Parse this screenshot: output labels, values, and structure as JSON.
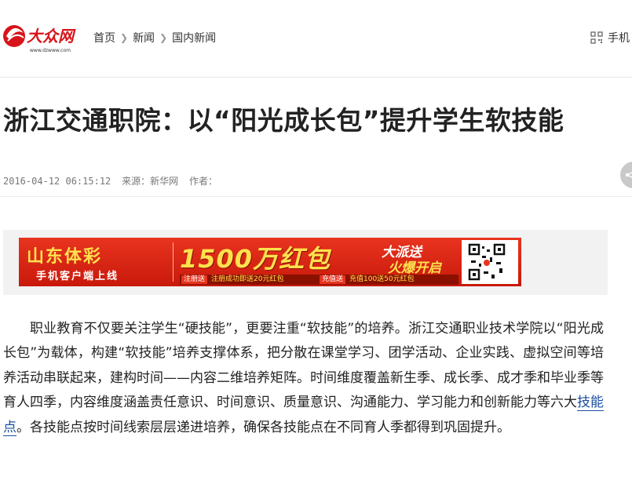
{
  "logo": {
    "name": "大众网",
    "domain": "www.dzwww.com"
  },
  "breadcrumb": {
    "items": [
      "首页",
      "新闻",
      "国内新闻"
    ]
  },
  "header": {
    "mobile_label": "手机"
  },
  "article": {
    "title": "浙江交通职院：以“阳光成长包”提升学生软技能",
    "date": "2016-04-12 06:15:12",
    "source": "来源：新华网",
    "author": "作者：",
    "body_before_link": "职业教育不仅要关注学生“硬技能”，更要注重“软技能”的培养。浙江交通职业技术学院以“阳光成长包”为载体，构建“软技能”培养支撑体系，把分散在课堂学习、团学活动、企业实践、虚拟空间等培养活动串联起来，建构时间——内容二维培养矩阵。时间维度覆盖新生季、成长季、成才季和毕业季等育人四季，内容维度涵盖责任意识、时间意识、质量意识、沟通能力、学习能力和创新能力等六大",
    "link_text": "技能点",
    "body_after_link": "。各技能点按时间线索层层递进培养，确保各技能点在不同育人季都得到巩固提升。"
  },
  "ad": {
    "brand": "山东体彩",
    "brand_sub": "手机客户端上线",
    "headline": "1500万红包",
    "slogan_1": "大派送",
    "slogan_2": "火爆开启",
    "tag_1": "注册送",
    "note_1": "注册成功即送20元红包",
    "tag_2": "充值送",
    "note_2": "充值100送50元红包"
  },
  "colors": {
    "ad_red": "#e8341f",
    "ad_yellow": "#ffe14d",
    "link": "#1a4fa0",
    "logo_red": "#d7141a"
  }
}
